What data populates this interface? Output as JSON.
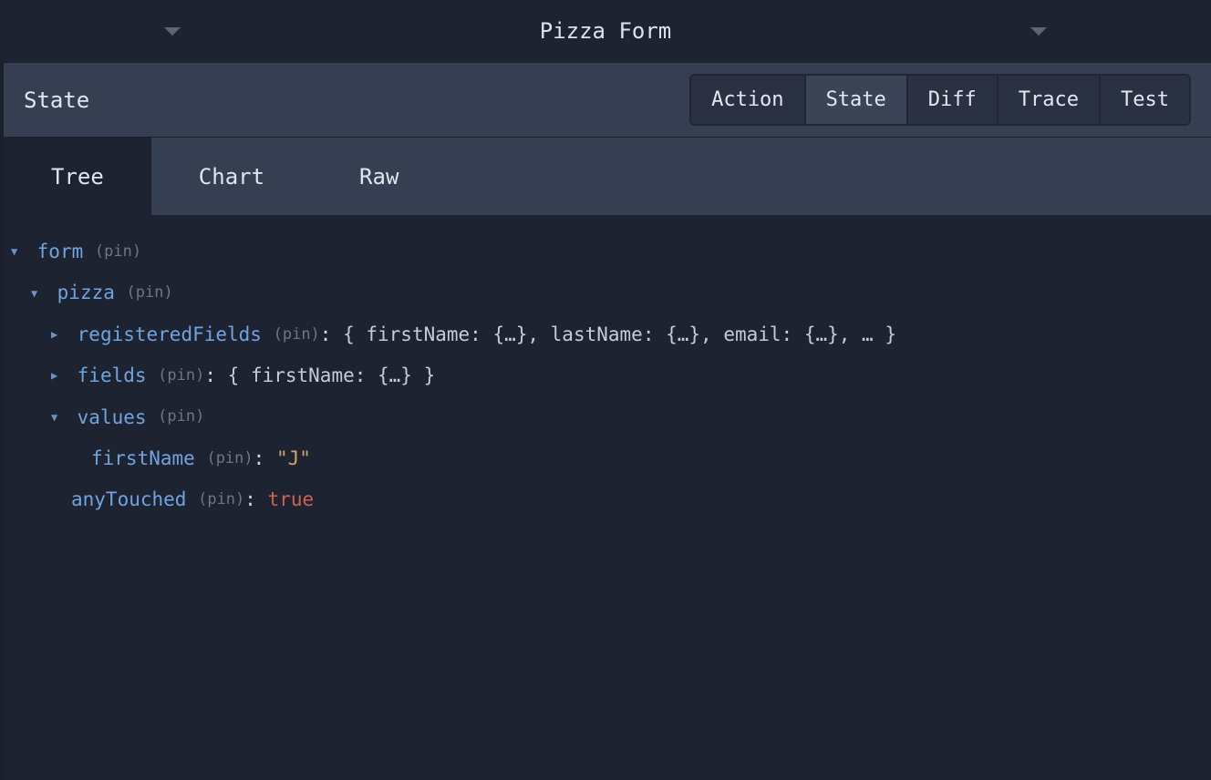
{
  "titleBar": {
    "title": "Pizza Form"
  },
  "toolbar": {
    "label": "State",
    "tabs": [
      "Action",
      "State",
      "Diff",
      "Trace",
      "Test"
    ],
    "activeTab": "State"
  },
  "viewTabs": {
    "tabs": [
      "Tree",
      "Chart",
      "Raw"
    ],
    "activeTab": "Tree"
  },
  "pinLabel": "(pin)",
  "tree": {
    "form": {
      "key": "form",
      "pizza": {
        "key": "pizza",
        "registeredFields": {
          "key": "registeredFields",
          "preview": "{ firstName: {…}, lastName: {…}, email: {…}, … }"
        },
        "fields": {
          "key": "fields",
          "preview": "{ firstName: {…} }"
        },
        "values": {
          "key": "values",
          "firstName": {
            "key": "firstName",
            "value": "\"J\""
          }
        },
        "anyTouched": {
          "key": "anyTouched",
          "value": "true"
        }
      }
    }
  }
}
